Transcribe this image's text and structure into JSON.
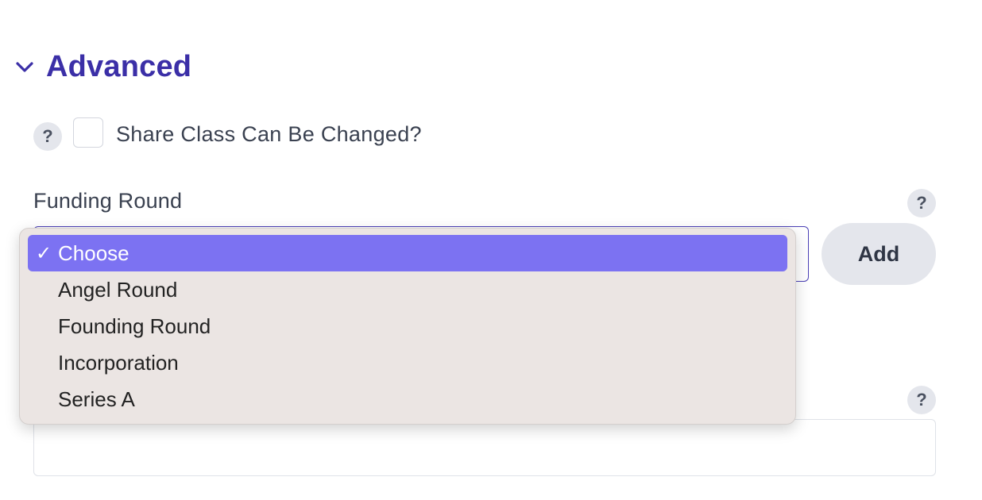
{
  "section": {
    "title": "Advanced",
    "toggle_icon": "chevron-down-icon"
  },
  "share_class": {
    "help_glyph": "?",
    "label": "Share Class Can Be Changed?",
    "checked": false
  },
  "funding_round": {
    "label": "Funding Round",
    "help_glyph": "?",
    "add_label": "Add",
    "options": [
      {
        "label": "Choose",
        "selected": true,
        "check": "✓"
      },
      {
        "label": "Angel Round",
        "selected": false
      },
      {
        "label": "Founding Round",
        "selected": false
      },
      {
        "label": "Incorporation",
        "selected": false
      },
      {
        "label": "Series A",
        "selected": false
      }
    ]
  },
  "lower_field": {
    "help_glyph": "?",
    "value": ""
  },
  "colors": {
    "accent": "#3b2fa7",
    "selected_option": "#7c72f2",
    "menu_background": "#ebe5e3"
  }
}
